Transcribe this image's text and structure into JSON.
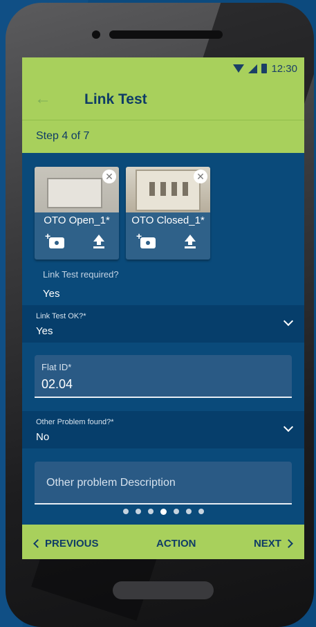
{
  "status_bar": {
    "time": "12:30",
    "icons": [
      "wifi-icon",
      "signal-icon",
      "battery-icon"
    ]
  },
  "app_bar": {
    "title": "Link Test",
    "back_icon": "arrow-left-icon"
  },
  "step": {
    "label": "Step 4 of 7"
  },
  "photos": [
    {
      "label": "OTO Open_1*",
      "icons": [
        "close-icon",
        "add-photo-icon",
        "upload-icon"
      ]
    },
    {
      "label": "OTO Closed_1*",
      "icons": [
        "close-icon",
        "add-photo-icon",
        "upload-icon"
      ]
    }
  ],
  "link_test_required": {
    "label": "Link Test required?",
    "value": "Yes"
  },
  "link_test_ok": {
    "label": "Link Test OK?*",
    "value": "Yes"
  },
  "flat_id": {
    "label": "Flat ID*",
    "value": "02.04"
  },
  "other_problem": {
    "label": "Other Problem found?*",
    "value": "No"
  },
  "other_problem_description": {
    "placeholder": "Other problem Description"
  },
  "pagination": {
    "total": 7,
    "active_index": 3
  },
  "bottom_bar": {
    "previous_label": "PREVIOUS",
    "action_label": "ACTION",
    "next_label": "NEXT"
  },
  "colors": {
    "accent": "#a8d05c",
    "primary": "#0a4a7a",
    "text_dark": "#0f3c66"
  }
}
